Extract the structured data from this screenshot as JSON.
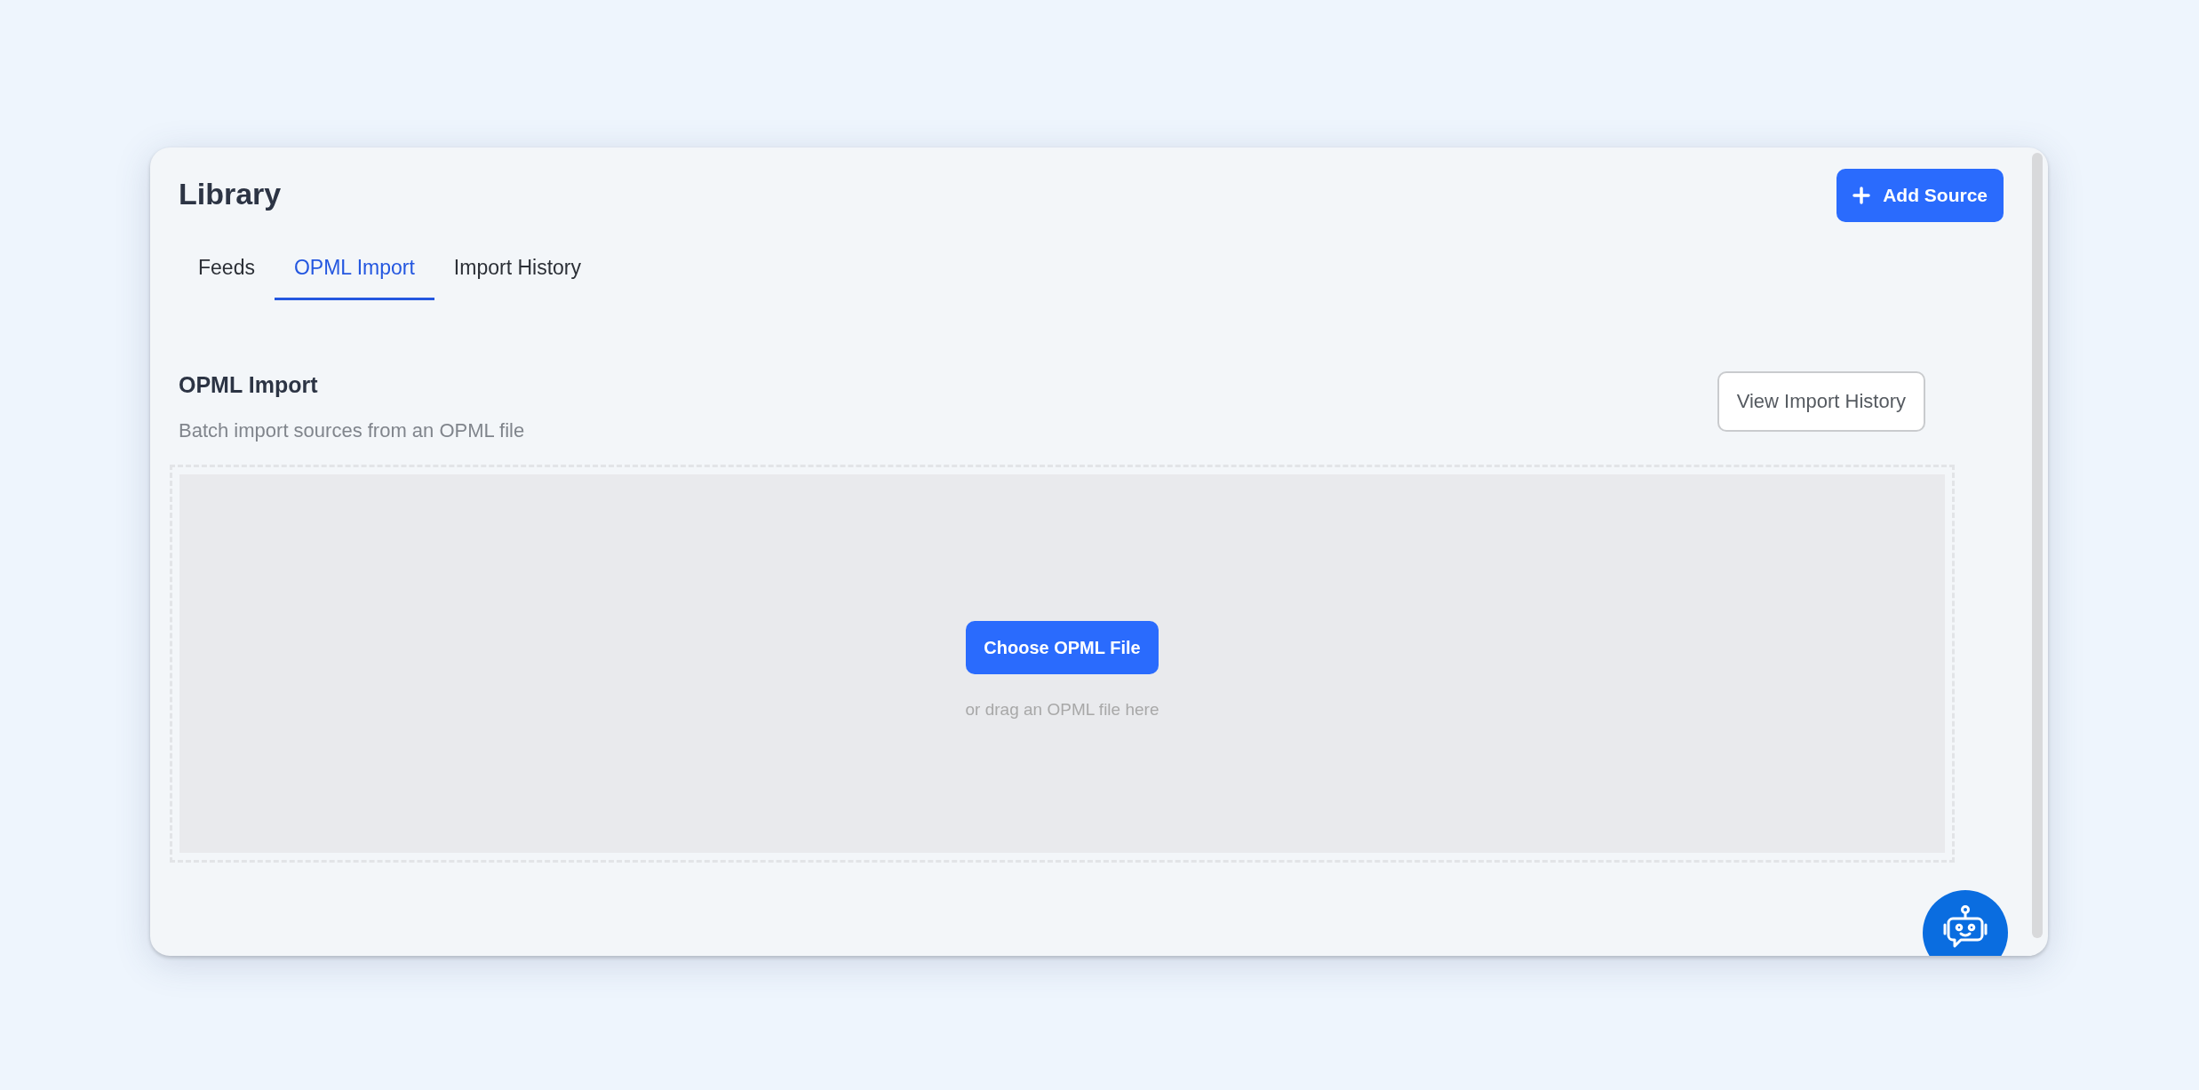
{
  "page": {
    "title": "Library"
  },
  "add_button": {
    "label": "Add Source"
  },
  "tabs": [
    {
      "label": "Feeds",
      "selected": false
    },
    {
      "label": "OPML Import",
      "selected": true
    },
    {
      "label": "Import History",
      "selected": false
    }
  ],
  "section": {
    "title": "OPML Import",
    "subtitle": "Batch import sources from an OPML file",
    "history_button": "View Import History"
  },
  "dropzone": {
    "button": "Choose OPML File",
    "hint": "or drag an OPML file here"
  }
}
